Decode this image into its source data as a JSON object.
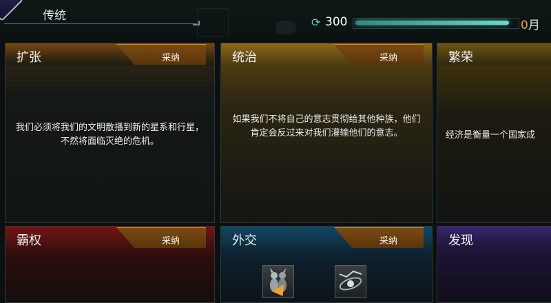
{
  "header": {
    "title": "传统",
    "unity_value": "300",
    "months_value": "0",
    "months_unit": "月",
    "progress_fraction": 0.96
  },
  "colors": {
    "accent_teal": "#6fd7c3",
    "months_orange": "#f3a23d",
    "adopt_orange": "#7a4a13"
  },
  "cards": {
    "expansion": {
      "title": "扩张",
      "adopt": "采纳",
      "desc": "我们必须将我们的文明散播到新的星系和行星，不然将面临灭绝的危机。"
    },
    "domination": {
      "title": "统治",
      "adopt": "采纳",
      "desc": "如果我们不将自己的意志贯彻给其他种族，他们肯定会反过来对我们灌输他们的意志。"
    },
    "prosperity": {
      "title": "繁荣",
      "desc": "经济是衡量一个国家成"
    },
    "supremacy": {
      "title": "霸权",
      "adopt": "采纳"
    },
    "diplomacy": {
      "title": "外交",
      "adopt": "采纳"
    },
    "discovery": {
      "title": "发现"
    }
  },
  "icons": {
    "unity": "unity-icon",
    "emblem": "empire-emblem-icon"
  }
}
